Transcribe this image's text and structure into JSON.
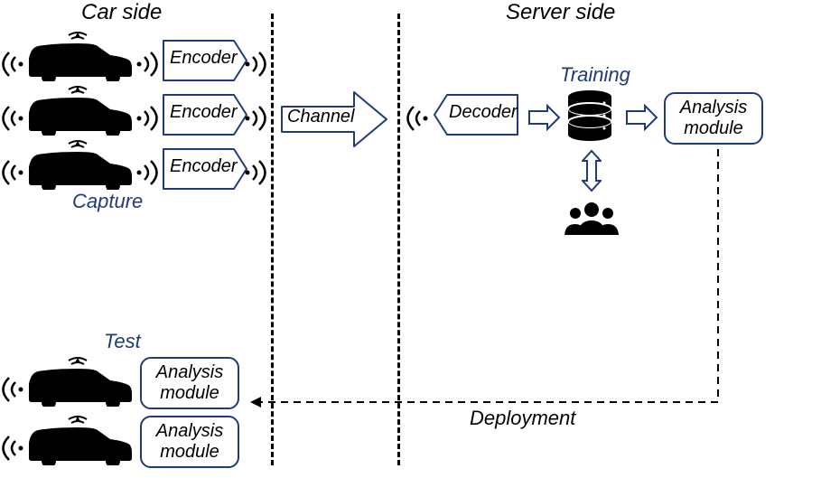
{
  "headings": {
    "car_side": "Car side",
    "server_side": "Server side"
  },
  "labels": {
    "capture": "Capture",
    "channel": "Channel",
    "training": "Training",
    "test": "Test",
    "deployment": "Deployment"
  },
  "blocks": {
    "encoder": "Encoder",
    "decoder": "Decoder",
    "analysis_module": "Analysis\nmodule"
  },
  "icons": {
    "car": "car-icon",
    "wireless": "wireless-icon",
    "database": "database-icon",
    "people": "people-icon"
  }
}
